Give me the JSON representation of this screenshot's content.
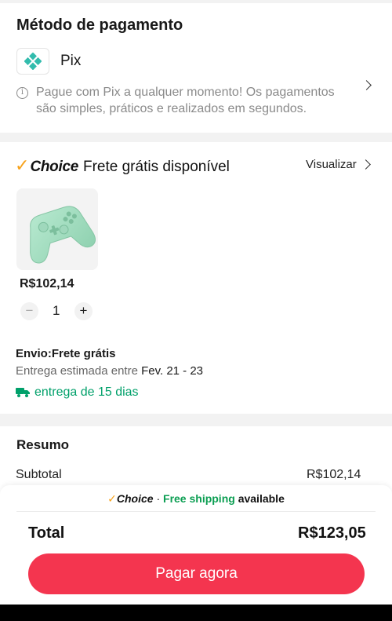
{
  "payment": {
    "title": "Método de pagamento",
    "method_name": "Pix",
    "info_text": "Pague com Pix a qualquer momento! Os pagamentos são simples, práticos e realizados em segundos.",
    "info_icon": "i"
  },
  "choice": {
    "check": "✓",
    "brand": "Choice",
    "free_shipping_text": "Frete grátis disponível",
    "view_label": "Visualizar",
    "product": {
      "price": "R$102,14",
      "quantity": "1",
      "minus": "−",
      "plus": "+"
    },
    "shipping_label": "Envio:Frete grátis",
    "eta_prefix": "Entrega estimada entre ",
    "eta_dates": "Fev. 21 - 23",
    "delivery_text": "entrega de 15 dias"
  },
  "summary": {
    "title": "Resumo",
    "subtotal_label": "Subtotal",
    "subtotal_value": "R$102,14"
  },
  "footer": {
    "banner_check": "✓",
    "banner_choice": "Choice",
    "banner_dot": " · ",
    "banner_free": "Free shipping",
    "banner_available": " available",
    "total_label": "Total",
    "total_value": "R$123,05",
    "pay_button": "Pagar agora"
  },
  "colors": {
    "accent_button": "#f4354f",
    "choice_check": "#f7a21b",
    "delivery_green": "#00a06a",
    "pix_teal": "#32bcad"
  }
}
